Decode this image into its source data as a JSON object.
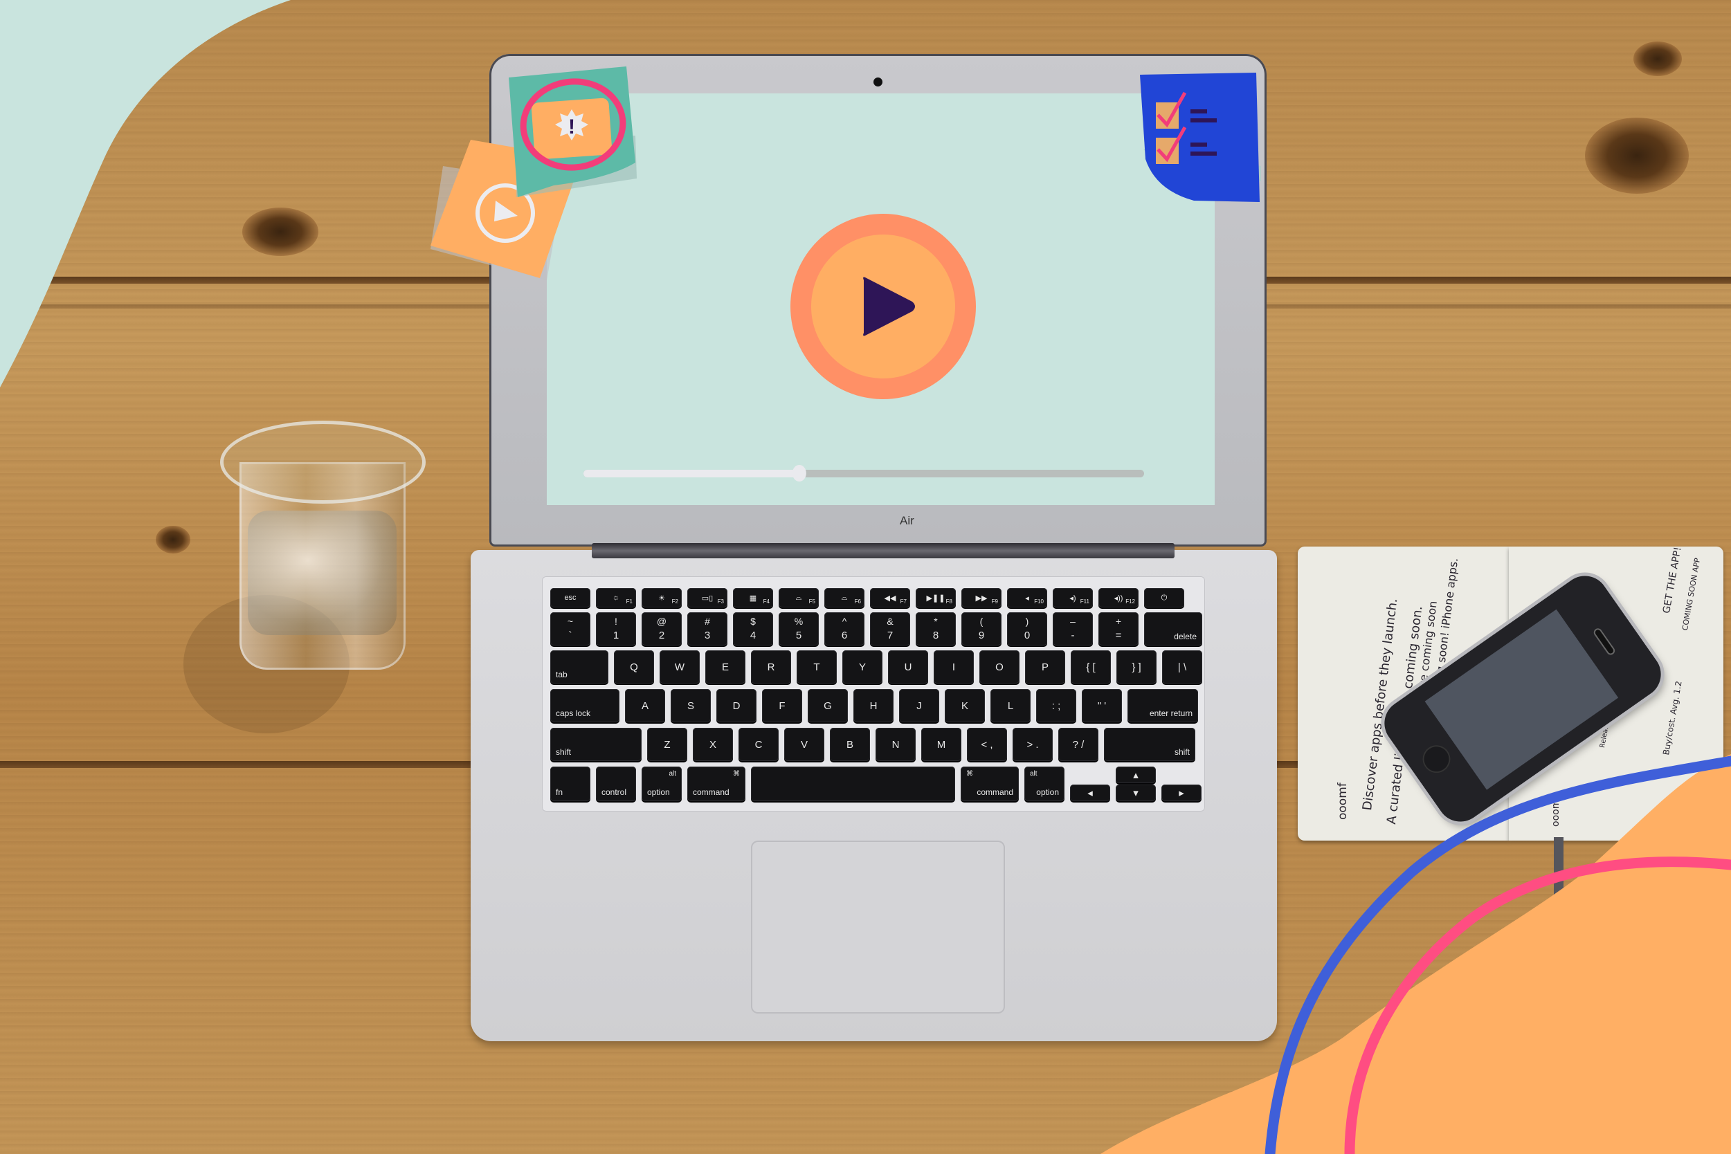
{
  "scene": {
    "description": "Top-down photo of a laptop on a wooden desk with an illustrated video player on its screen",
    "background_accent_top_left": "#c9e4de",
    "background_accent_bottom_right": "#ffaf64",
    "stroke_colors": [
      "#3f5fd9",
      "#ff4d82"
    ]
  },
  "laptop": {
    "brand_label": "Air",
    "screen": {
      "background": "#c9e4de",
      "play_button": {
        "icon": "play-icon",
        "outer_color": "#ff9066",
        "inner_color": "#ffae63",
        "glyph_color": "#2e1557"
      },
      "progress": {
        "played_fraction": 0.385,
        "played_color": "#eaeaee",
        "remaining_color": "#b9bebc"
      }
    },
    "stickies": [
      {
        "name": "alert-sticky",
        "color": "#5dbaa7",
        "icon": "alert-badge-icon",
        "icon_text": "!",
        "circle_color": "#f23d7a"
      },
      {
        "name": "video-sticky",
        "color": "#ffae63",
        "icon": "play-circle-icon"
      },
      {
        "name": "checklist-sticky",
        "color": "#2145d6",
        "items": 2,
        "icon": "checkbox-checked-icon"
      }
    ],
    "keyboard": {
      "function_row": [
        {
          "label": "esc"
        },
        {
          "label": "F1",
          "icon": "☼"
        },
        {
          "label": "F2",
          "icon": "☀"
        },
        {
          "label": "F3",
          "icon": "▭▯"
        },
        {
          "label": "F4",
          "icon": "▦"
        },
        {
          "label": "F5",
          "icon": "⌓"
        },
        {
          "label": "F6",
          "icon": "⌓"
        },
        {
          "label": "F7",
          "icon": "◀◀"
        },
        {
          "label": "F8",
          "icon": "▶❚❚"
        },
        {
          "label": "F9",
          "icon": "▶▶"
        },
        {
          "label": "F10",
          "icon": "◂"
        },
        {
          "label": "F11",
          "icon": "◂)"
        },
        {
          "label": "F12",
          "icon": "◂))"
        },
        {
          "label": "",
          "icon": "⏻"
        }
      ],
      "number_row": [
        {
          "top": "~",
          "bottom": "`"
        },
        {
          "top": "!",
          "bottom": "1"
        },
        {
          "top": "@",
          "bottom": "2"
        },
        {
          "top": "#",
          "bottom": "3"
        },
        {
          "top": "$",
          "bottom": "4"
        },
        {
          "top": "%",
          "bottom": "5"
        },
        {
          "top": "^",
          "bottom": "6"
        },
        {
          "top": "&",
          "bottom": "7"
        },
        {
          "top": "*",
          "bottom": "8"
        },
        {
          "top": "(",
          "bottom": "9"
        },
        {
          "top": ")",
          "bottom": "0"
        },
        {
          "top": "–",
          "bottom": "-"
        },
        {
          "top": "+",
          "bottom": "="
        },
        {
          "top": "",
          "bottom": "delete"
        }
      ],
      "qwerty_row": [
        "tab",
        "Q",
        "W",
        "E",
        "R",
        "T",
        "Y",
        "U",
        "I",
        "O",
        "P",
        "{ [",
        "} ]",
        "| \\"
      ],
      "home_row": [
        "caps lock",
        "A",
        "S",
        "D",
        "F",
        "G",
        "H",
        "J",
        "K",
        "L",
        ": ;",
        "\" '",
        "enter return"
      ],
      "shift_row": [
        "shift",
        "Z",
        "X",
        "C",
        "V",
        "B",
        "N",
        "M",
        "< ,",
        "> .",
        "? /",
        "shift"
      ],
      "bottom_row": [
        {
          "label": "fn"
        },
        {
          "label": "control"
        },
        {
          "label": "option",
          "top": "alt"
        },
        {
          "label": "command",
          "top": "⌘"
        },
        {
          "label": ""
        },
        {
          "label": "command",
          "top": "⌘"
        },
        {
          "label": "option",
          "top": "alt"
        }
      ],
      "arrows": {
        "left": "◂",
        "up": "▴",
        "down": "▾",
        "right": "▸"
      }
    }
  },
  "notebook": {
    "left_page_lines": [
      "Discover apps before they launch.",
      "A curated list of apps coming soon.",
      "apps that are coming soon",
      "coming soon! iPhone apps.",
      "ooomf"
    ],
    "right_page_lines": [
      "GET THE APP!",
      "COMING SOON APP",
      "Release Date",
      "Buy/cost. Avg. 1.2",
      "ooomf"
    ]
  }
}
